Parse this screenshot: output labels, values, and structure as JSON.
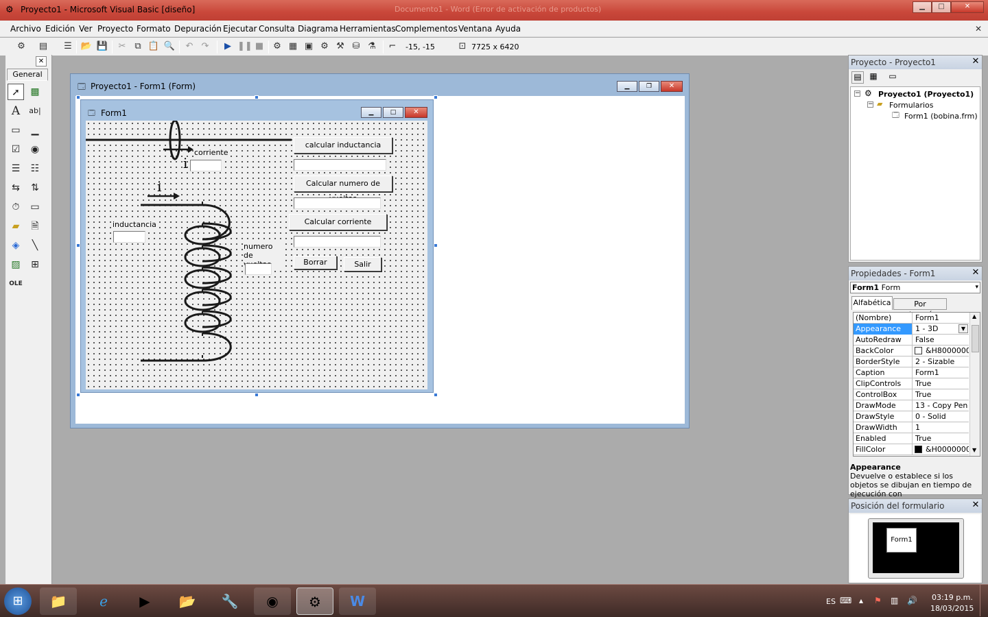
{
  "window": {
    "title": "Proyecto1 - Microsoft Visual Basic [diseño]",
    "background_title": "Documento1 - Word (Error de activación de productos)",
    "minimize": "▁",
    "maximize": "□",
    "close": "✕"
  },
  "menu": [
    "Archivo",
    "Edición",
    "Ver",
    "Proyecto",
    "Formato",
    "Depuración",
    "Ejecutar",
    "Consulta",
    "Diagrama",
    "Herramientas",
    "Complementos",
    "Ventana",
    "Ayuda"
  ],
  "toolbar": {
    "position": "-15, -15",
    "size": "7725 x 6420"
  },
  "toolbox": {
    "title": "General",
    "close": "✕"
  },
  "form_window": {
    "title": "Proyecto1 - Form1 (Form)"
  },
  "form1": {
    "caption": "Form1",
    "labels": {
      "corriente": "corriente",
      "i_top": "i",
      "i_coil": "i",
      "inductancia": "inductancia",
      "numero_vueltas": "numero de vueltas"
    },
    "buttons": {
      "calc_inductancia": "calcular inductancia",
      "calc_vueltas": "Calcular numero de vueltas",
      "calc_corriente": "Calcular corriente",
      "borrar": "Borrar",
      "salir": "Salir"
    }
  },
  "project_panel": {
    "title": "Proyecto - Proyecto1",
    "tree": {
      "root": "Proyecto1 (Proyecto1)",
      "folder": "Formularios",
      "item": "Form1 (bobina.frm)"
    }
  },
  "properties_panel": {
    "title": "Propiedades - Form1",
    "object_bold": "Form1",
    "object_type": "Form",
    "tabs": [
      "Alfabética",
      "Por categorías"
    ],
    "rows": [
      {
        "name": "(Nombre)",
        "value": "Form1"
      },
      {
        "name": "Appearance",
        "value": "1 - 3D",
        "selected": true
      },
      {
        "name": "AutoRedraw",
        "value": "False"
      },
      {
        "name": "BackColor",
        "value": "&H8000000F",
        "swatch": "#ffffff"
      },
      {
        "name": "BorderStyle",
        "value": "2 - Sizable"
      },
      {
        "name": "Caption",
        "value": "Form1"
      },
      {
        "name": "ClipControls",
        "value": "True"
      },
      {
        "name": "ControlBox",
        "value": "True"
      },
      {
        "name": "DrawMode",
        "value": "13 - Copy Pen"
      },
      {
        "name": "DrawStyle",
        "value": "0 - Solid"
      },
      {
        "name": "DrawWidth",
        "value": "1"
      },
      {
        "name": "Enabled",
        "value": "True"
      },
      {
        "name": "FillColor",
        "value": "&H00000000",
        "swatch": "#000000"
      }
    ],
    "desc_title": "Appearance",
    "desc_text": "Devuelve o establece si los objetos se dibujan en tiempo de ejecución con"
  },
  "layout_panel": {
    "title": "Posición del formulario",
    "form_label": "Form1"
  },
  "taskbar": {
    "lang": "ES",
    "time": "03:19 p.m.",
    "date": "18/03/2015"
  },
  "colors": {
    "title_bar": "#c9473a",
    "selection": "#3399ff",
    "taskbar": "#4a322c"
  }
}
